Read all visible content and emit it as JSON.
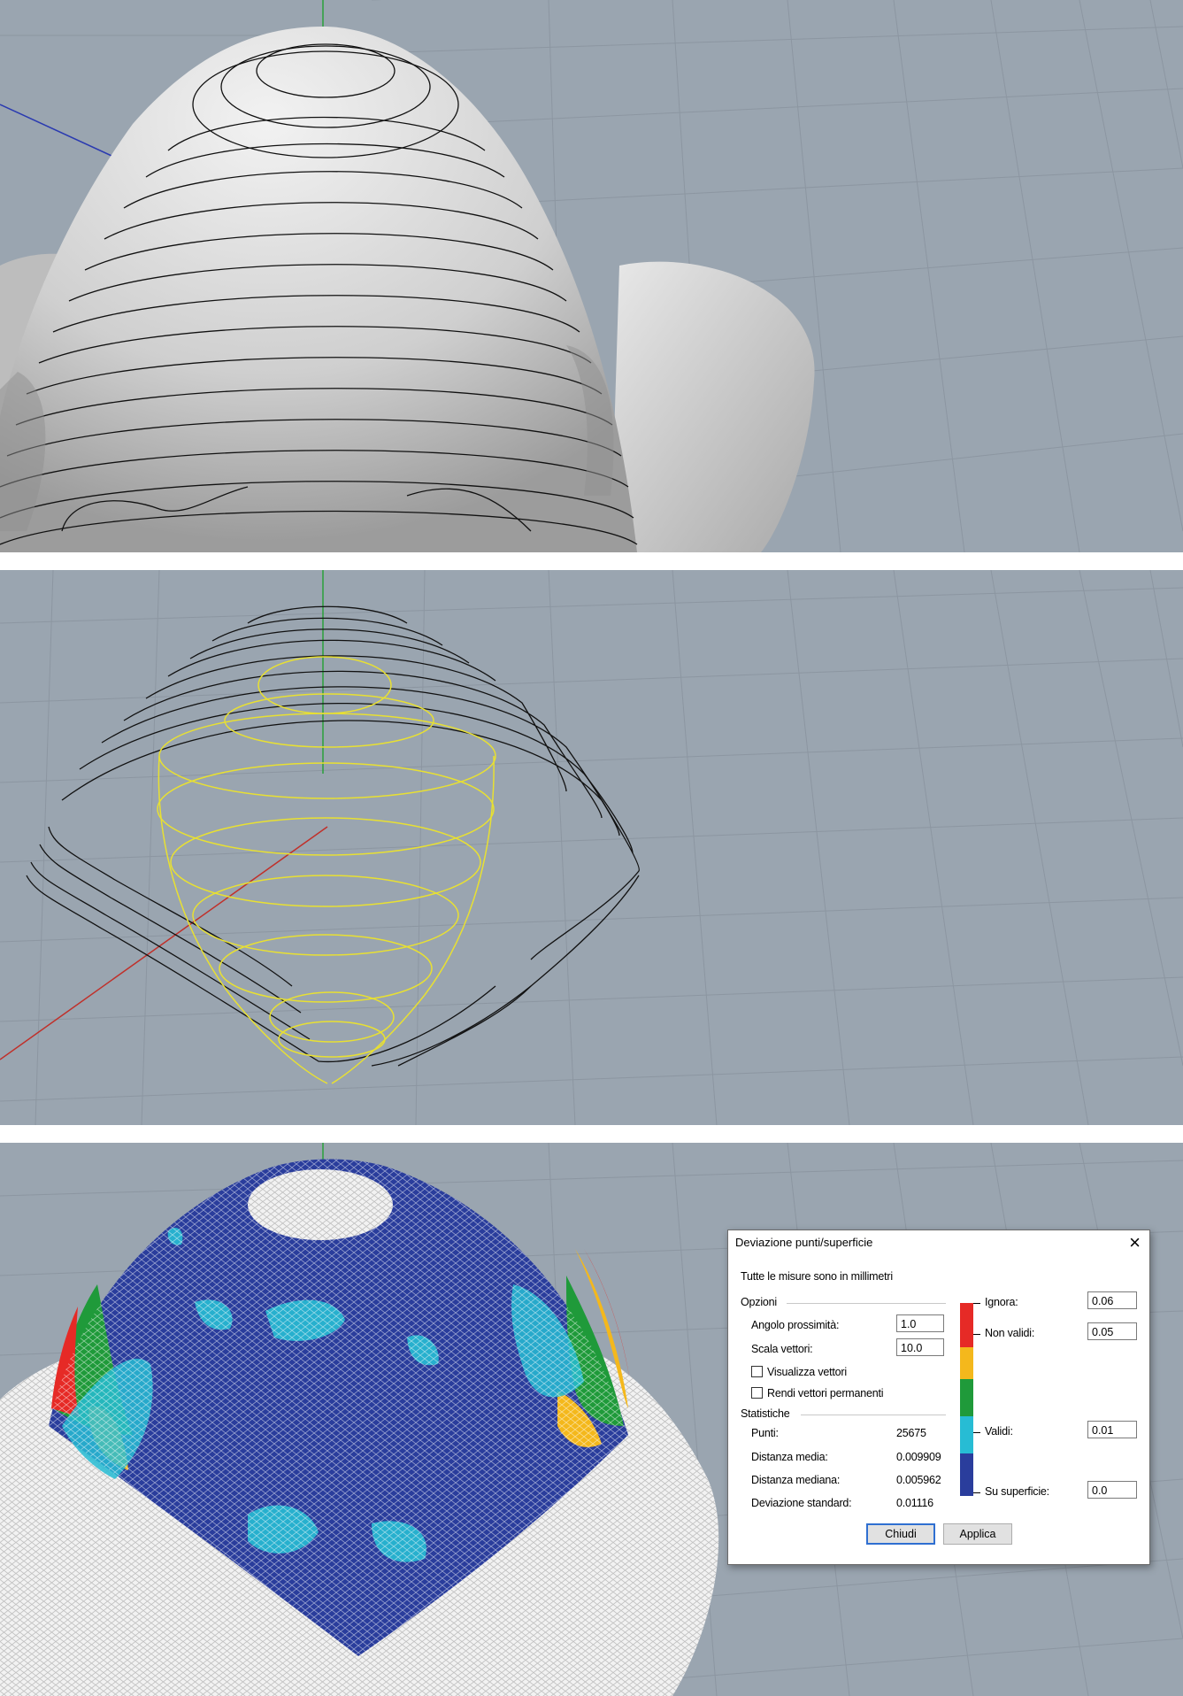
{
  "panels": [
    {
      "name": "contour-curves-on-surface-view"
    },
    {
      "name": "wireframe-contours-view"
    },
    {
      "name": "point-deviation-view"
    }
  ],
  "colors": {
    "viewport_bg": "#9aa5b0",
    "grid": "#8e98a3",
    "axis_x": "#c0302a",
    "axis_y": "#2aa03a",
    "axis_z": "#2a3ab0",
    "contour": "#111111",
    "section": "#e8e032",
    "deviation_red": "#e62a26",
    "deviation_orange": "#f4b81c",
    "deviation_green": "#1f9a3a",
    "deviation_cyan": "#27bcd4",
    "deviation_blue": "#2a3d9c"
  },
  "dialog": {
    "title": "Deviazione punti/superficie",
    "close_icon": "×",
    "units_note": "Tutte le misure sono in millimetri",
    "options": {
      "heading": "Opzioni",
      "proximity_label": "Angolo prossimità:",
      "proximity_value": "1.0",
      "vector_scale_label": "Scala vettori:",
      "vector_scale_value": "10.0",
      "show_vectors_label": "Visualizza vettori",
      "show_vectors_checked": false,
      "permanent_vectors_label": "Rendi vettori permanenti",
      "permanent_vectors_checked": false
    },
    "stats": {
      "heading": "Statistiche",
      "points_label": "Punti:",
      "points_value": "25675",
      "mean_label": "Distanza media:",
      "mean_value": "0.009909",
      "median_label": "Distanza mediana:",
      "median_value": "0.005962",
      "stddev_label": "Deviazione standard:",
      "stddev_value": "0.01116"
    },
    "legend": {
      "ignore_label": "Ignora:",
      "ignore_value": "0.06",
      "invalid_label": "Non validi:",
      "invalid_value": "0.05",
      "valid_label": "Validi:",
      "valid_value": "0.01",
      "on_surface_label": "Su superficie:",
      "on_surface_value": "0.0"
    },
    "buttons": {
      "close_label": "Chiudi",
      "apply_label": "Applica"
    }
  }
}
